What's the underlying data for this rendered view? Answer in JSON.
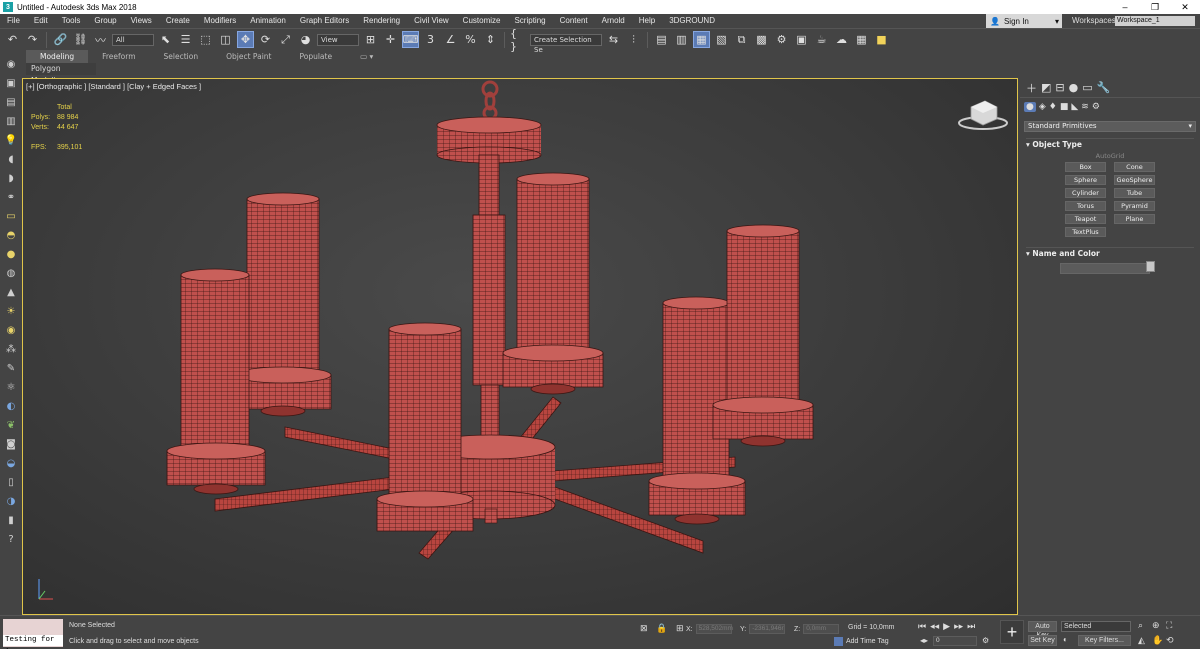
{
  "window": {
    "title": "Untitled - Autodesk 3ds Max 2018",
    "app_icon_letter": "3",
    "minimize": "–",
    "maximize": "❐",
    "close": "✕"
  },
  "menu": {
    "items": [
      "File",
      "Edit",
      "Tools",
      "Group",
      "Views",
      "Create",
      "Modifiers",
      "Animation",
      "Graph Editors",
      "Rendering",
      "Civil View",
      "Customize",
      "Scripting",
      "Content",
      "Arnold",
      "Help",
      "3DGROUND"
    ],
    "sign_in": "Sign In",
    "workspaces_label": "Workspaces:",
    "workspace_value": "Workspace_1"
  },
  "toolbar": {
    "filter_value": "All",
    "refcoord_value": "View",
    "selection_set_placeholder": "Create Selection Se"
  },
  "ribbon": {
    "tabs": [
      "Modeling",
      "Freeform",
      "Selection",
      "Object Paint",
      "Populate"
    ],
    "sub_label": "Polygon Modeling"
  },
  "viewport": {
    "label": "[+] [Orthographic ] [Standard ] [Clay + Edged Faces ]",
    "stats": {
      "total_label": "Total",
      "polys_label": "Polys:",
      "polys_value": "88 984",
      "verts_label": "Verts:",
      "verts_value": "44 647",
      "fps_label": "FPS:",
      "fps_value": "395,101"
    }
  },
  "command_panel": {
    "category": "Standard Primitives",
    "object_type_title": "Object Type",
    "autogrid_label": "AutoGrid",
    "object_buttons": [
      "Box",
      "Cone",
      "Sphere",
      "GeoSphere",
      "Cylinder",
      "Tube",
      "Torus",
      "Pyramid",
      "Teapot",
      "Plane",
      "TextPlus"
    ],
    "name_color_title": "Name and Color"
  },
  "status": {
    "maxscript_text": "Testing for :",
    "selection_info": "None Selected",
    "prompt": "Click and drag to select and move objects",
    "x_label": "X:",
    "x_value": "528,502mm",
    "y_label": "Y:",
    "y_value": "-2361,946r",
    "z_label": "Z:",
    "z_value": "0,0mm",
    "grid": "Grid = 10,0mm",
    "add_time_tag": "Add Time Tag",
    "frame_value": "0",
    "auto_key": "Auto Key",
    "set_key": "Set Key",
    "key_mode": "Selected",
    "key_filters": "Key Filters..."
  },
  "colors": {
    "viewport_border": "#e0c54a",
    "stats_text": "#e6d24a",
    "model": "#c0504d",
    "wire": "#3a1512",
    "accent": "#5b7bb5"
  }
}
